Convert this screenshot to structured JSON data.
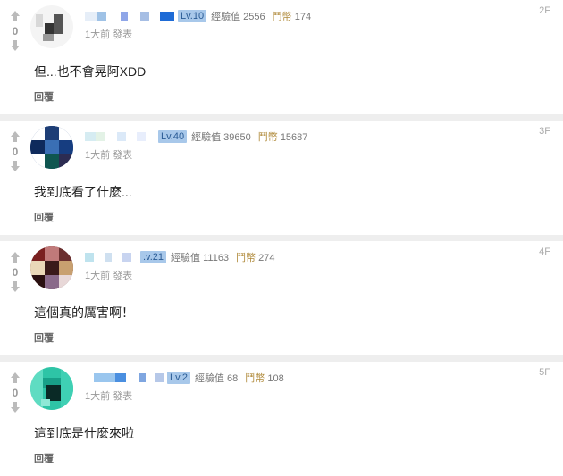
{
  "comments": [
    {
      "vote_count": "0",
      "level": "Lv.10",
      "exp_label": "經驗值",
      "exp_value": "2556",
      "coin_label": "鬥幣",
      "coin_value": "174",
      "time": "1大前",
      "action": "發表",
      "floor": "2F",
      "text": "但...也不會晃阿XDD",
      "reply_label": "回覆"
    },
    {
      "vote_count": "0",
      "level": "Lv.40",
      "exp_label": "經驗值",
      "exp_value": "39650",
      "coin_label": "鬥幣",
      "coin_value": "15687",
      "time": "1大前",
      "action": "發表",
      "floor": "3F",
      "text": "我到底看了什麼...",
      "reply_label": "回覆"
    },
    {
      "vote_count": "0",
      "level": ".v.21",
      "exp_label": "經驗值",
      "exp_value": "11163",
      "coin_label": "鬥幣",
      "coin_value": "274",
      "time": "1大前",
      "action": "發表",
      "floor": "4F",
      "text": "這個真的厲害啊！",
      "reply_label": "回覆"
    },
    {
      "vote_count": "0",
      "level": "Lv.2",
      "exp_label": "經驗值",
      "exp_value": "68",
      "coin_label": "鬥幣",
      "coin_value": "108",
      "time": "1大前",
      "action": "發表",
      "floor": "5F",
      "text": "這到底是什麼來啦",
      "reply_label": "回覆"
    }
  ],
  "icons": {
    "upvote": "up-arrow-icon",
    "downvote": "down-arrow-icon"
  },
  "colors": {
    "level_badge_bg": "#a8c8ea",
    "level_badge_text": "#2a5b95",
    "separator": "#eeeeee"
  }
}
